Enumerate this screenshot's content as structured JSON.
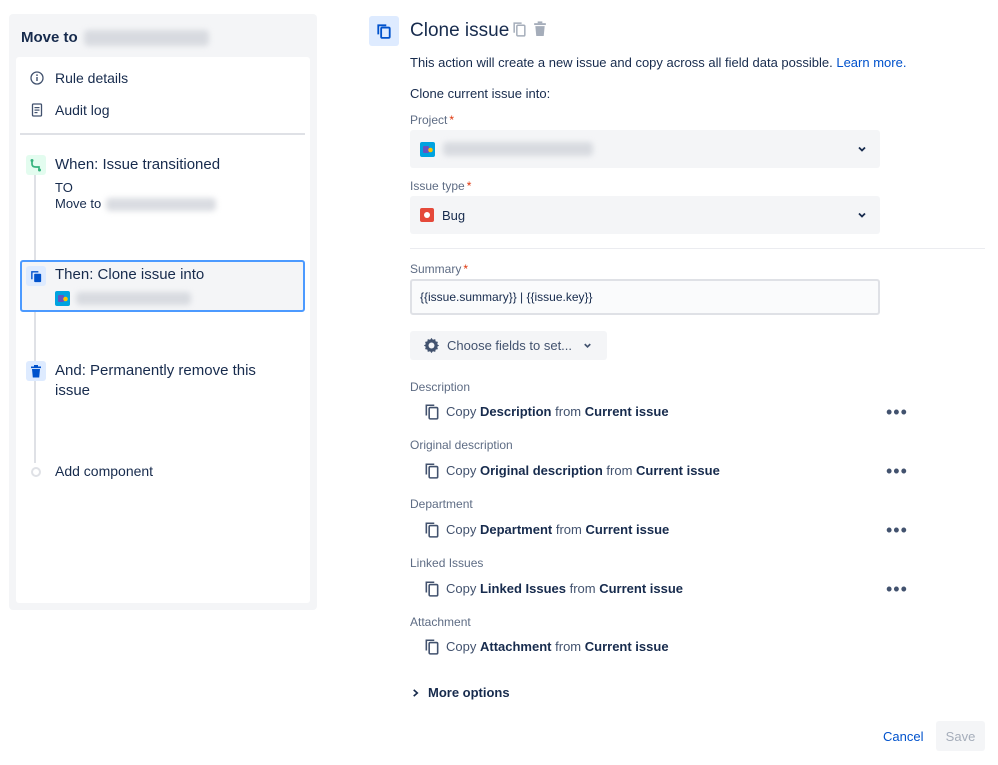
{
  "sidebar": {
    "rule_title": "Move to",
    "nav": {
      "rule_details": "Rule details",
      "audit_log": "Audit log"
    },
    "trigger": {
      "title": "When: Issue transitioned",
      "line1": "TO",
      "line2": "Move to"
    },
    "action": {
      "title": "Then: Clone issue into"
    },
    "remove": {
      "title": "And: Permanently remove this issue"
    },
    "add_component": "Add component"
  },
  "main": {
    "title": "Clone issue",
    "description": "This action will create a new issue and copy across all field data possible.",
    "learn_more": "Learn more.",
    "clone_into_label": "Clone current issue into:",
    "project_label": "Project",
    "issue_type_label": "Issue type",
    "issue_type_value": "Bug",
    "summary_label": "Summary",
    "summary_value": "{{issue.summary}} | {{issue.key}}",
    "choose_fields": "Choose fields to set...",
    "required_mark": "*",
    "copy_word": "Copy",
    "from_word": "from",
    "fields": [
      {
        "label": "Description",
        "field": "Description",
        "source": "Current issue"
      },
      {
        "label": "Original description",
        "field": "Original description",
        "source": "Current issue"
      },
      {
        "label": "Department",
        "field": "Department",
        "source": "Current issue"
      },
      {
        "label": "Linked Issues",
        "field": "Linked Issues",
        "source": "Current issue"
      },
      {
        "label": "Attachment",
        "field": "Attachment",
        "source": "Current issue"
      }
    ],
    "more_options": "More options",
    "cancel": "Cancel",
    "save": "Save"
  },
  "colors": {
    "accent": "#0052CC",
    "trigger_green": "#36B37E",
    "bug_red": "#E5493A",
    "selection_blue": "#4C9AFF"
  }
}
